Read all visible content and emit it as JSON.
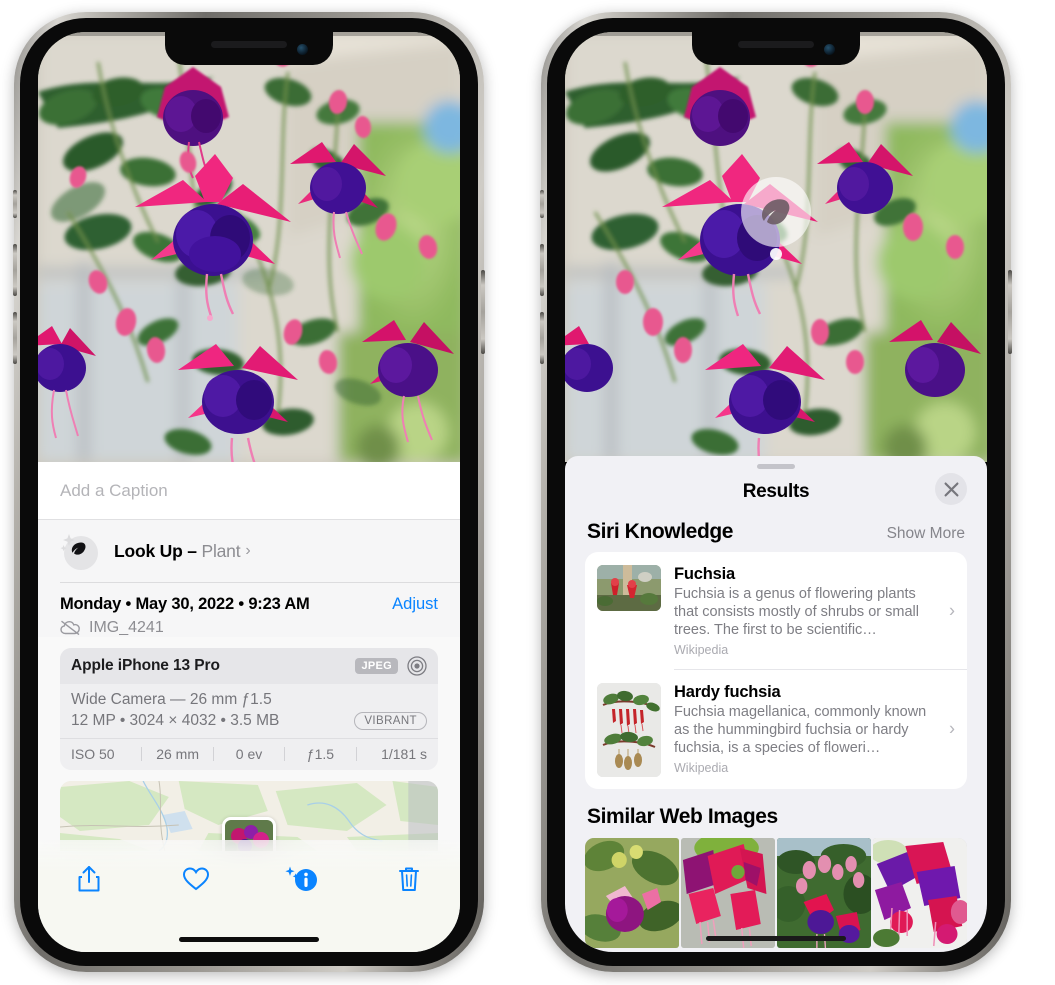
{
  "left_phone": {
    "caption": {
      "placeholder": "Add a Caption",
      "value": ""
    },
    "lookup": {
      "label": "Look Up ",
      "dash": "– ",
      "subject": "Plant",
      "chevron": "›",
      "icon": "leaf-icon"
    },
    "meta": {
      "date_line": "Monday • May 30, 2022 • 9:23 AM",
      "adjust_label": "Adjust",
      "filename": "IMG_4241",
      "cloud_icon": "icloud-slash-icon"
    },
    "camera_card": {
      "model": "Apple iPhone 13 Pro",
      "format_badge": "JPEG",
      "raw_icon": "aperture-icon",
      "lens_line": "Wide Camera — 26 mm ƒ1.5",
      "size_line": "12 MP • 3024 × 4032 • 3.5 MB",
      "style_badge": "VIBRANT",
      "exif": [
        "ISO 50",
        "26 mm",
        "0 ev",
        "ƒ1.5",
        "1/181 s"
      ]
    },
    "toolbar": {
      "share_label": "Share",
      "favorite_label": "Favorite",
      "info_label": "Info",
      "delete_label": "Delete"
    }
  },
  "right_phone": {
    "visual_lookup_badge": {
      "icon": "leaf-icon"
    },
    "sheet": {
      "title": "Results",
      "close_label": "Close"
    },
    "siri_knowledge": {
      "section_title": "Siri Knowledge",
      "show_more": "Show More",
      "items": [
        {
          "title": "Fuchsia",
          "description": "Fuchsia is a genus of flowering plants that consists mostly of shrubs or small trees. The first to be scientific…",
          "source": "Wikipedia",
          "chevron": "›"
        },
        {
          "title": "Hardy fuchsia",
          "description": "Fuchsia magellanica, commonly known as the hummingbird fuchsia or hardy fuchsia, is a species of floweri…",
          "source": "Wikipedia",
          "chevron": "›"
        }
      ]
    },
    "similar_web_images": {
      "section_title": "Similar Web Images",
      "thumbnails": [
        "fuchsia-pink-white",
        "fuchsia-red-closeup",
        "fuchsia-bush",
        "fuchsia-purple-red"
      ]
    }
  },
  "colors": {
    "accent_blue": "#0a84ff",
    "sheet_bg": "#f1f1f5",
    "info_bg": "#f6f6f7",
    "muted_text": "#8d8d92"
  }
}
